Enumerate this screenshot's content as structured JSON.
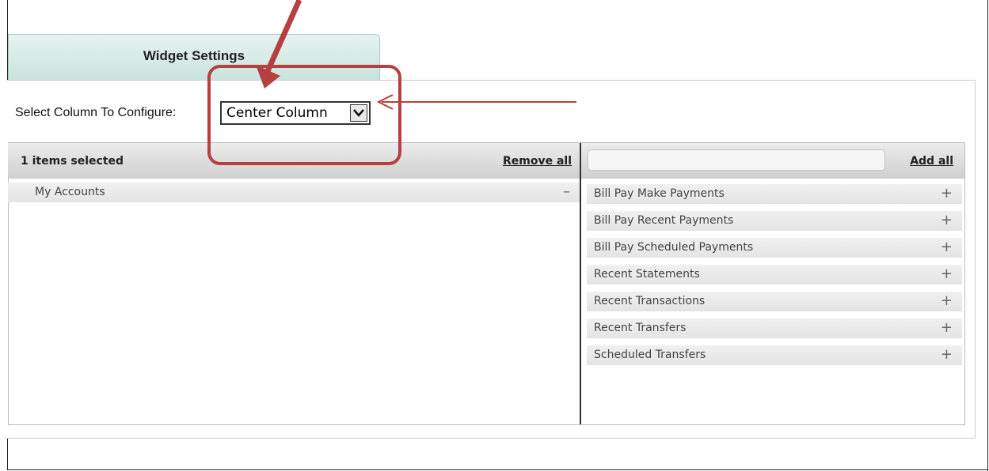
{
  "tab": {
    "label": "Widget Settings"
  },
  "column_select": {
    "label": "Select Column To Configure:",
    "value": "Center Column"
  },
  "selected_panel": {
    "header": "1 items selected",
    "remove_all": "Remove all",
    "items": [
      {
        "label": "My Accounts",
        "action": "–"
      }
    ]
  },
  "available_panel": {
    "search_placeholder": "",
    "add_all": "Add all",
    "items": [
      {
        "label": "Bill Pay Make Payments",
        "action": "+"
      },
      {
        "label": "Bill Pay Recent Payments",
        "action": "+"
      },
      {
        "label": "Bill Pay Scheduled Payments",
        "action": "+"
      },
      {
        "label": "Recent Statements",
        "action": "+"
      },
      {
        "label": "Recent Transactions",
        "action": "+"
      },
      {
        "label": "Recent Transfers",
        "action": "+"
      },
      {
        "label": "Scheduled Transfers",
        "action": "+"
      }
    ]
  },
  "colors": {
    "annotation": "#b5403f",
    "tab_bg": "#d7ebe6"
  }
}
